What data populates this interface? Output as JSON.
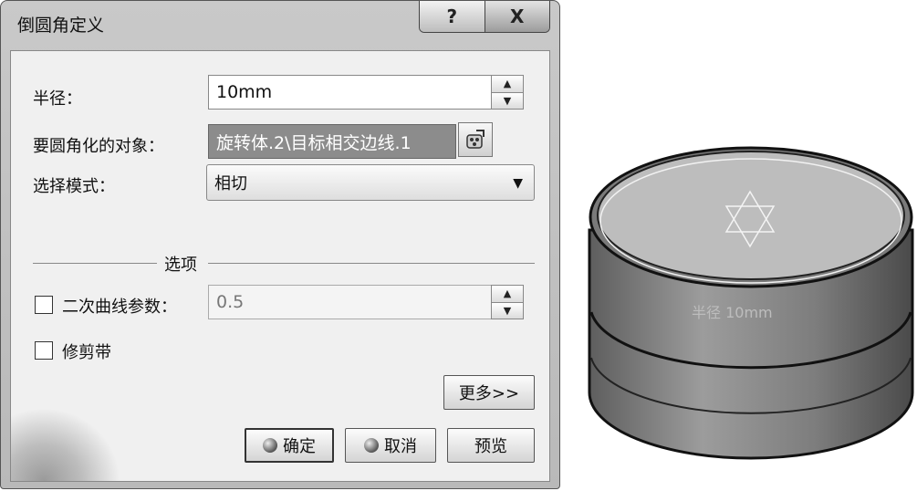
{
  "dialog": {
    "title": "倒圆角定义",
    "help_label": "?",
    "close_label": "X"
  },
  "radius": {
    "label": "半径：",
    "value": "10mm",
    "up": "▲",
    "down": "▼"
  },
  "objects": {
    "label": "要圆角化的对象：",
    "value": "旋转体.2\\目标相交边线.1",
    "icon": "multi-select-icon"
  },
  "selection_mode": {
    "label": "选择模式：",
    "value": "相切",
    "arrow": "▼"
  },
  "options": {
    "section_label": "选项",
    "conic": {
      "label": "二次曲线参数：",
      "value": "0.5",
      "checked": false
    },
    "trim": {
      "label": "修剪带",
      "checked": false
    }
  },
  "buttons": {
    "more": "更多>>",
    "ok": "确定",
    "cancel": "取消",
    "preview": "预览"
  },
  "viewport": {
    "radius_annotation": "半径 10mm"
  }
}
